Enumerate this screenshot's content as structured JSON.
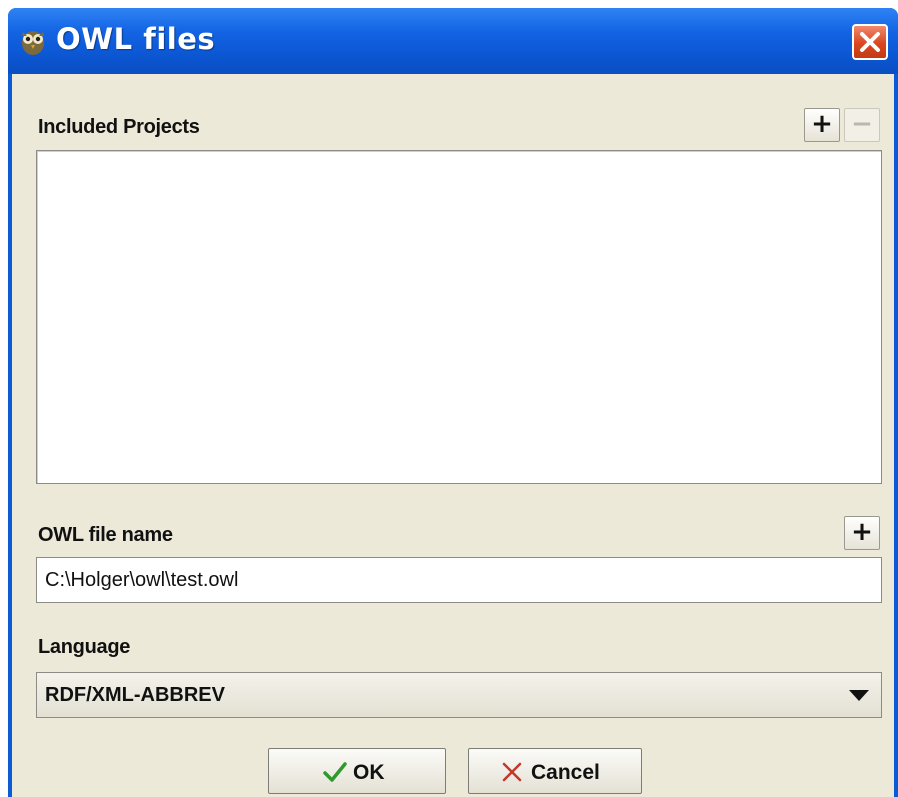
{
  "window": {
    "title": "OWL files",
    "icon": "owl-app-icon",
    "close_icon": "close-icon",
    "colors": {
      "titlebar": "#0c57d4",
      "close": "#d9461f",
      "panel": "#ece9d8"
    }
  },
  "included_projects": {
    "label": "Included Projects",
    "add_label": "+",
    "remove_label": "−",
    "items": []
  },
  "owl_file": {
    "label": "OWL file name",
    "browse_label": "+",
    "value": "C:\\Holger\\owl\\test.owl"
  },
  "language": {
    "label": "Language",
    "selected": "RDF/XML-ABBREV"
  },
  "buttons": {
    "ok_label": "OK",
    "ok_icon": "checkmark-icon",
    "cancel_label": "Cancel",
    "cancel_icon": "x-icon",
    "ok_color": "#2e9a2e",
    "cancel_color": "#c0392b"
  }
}
